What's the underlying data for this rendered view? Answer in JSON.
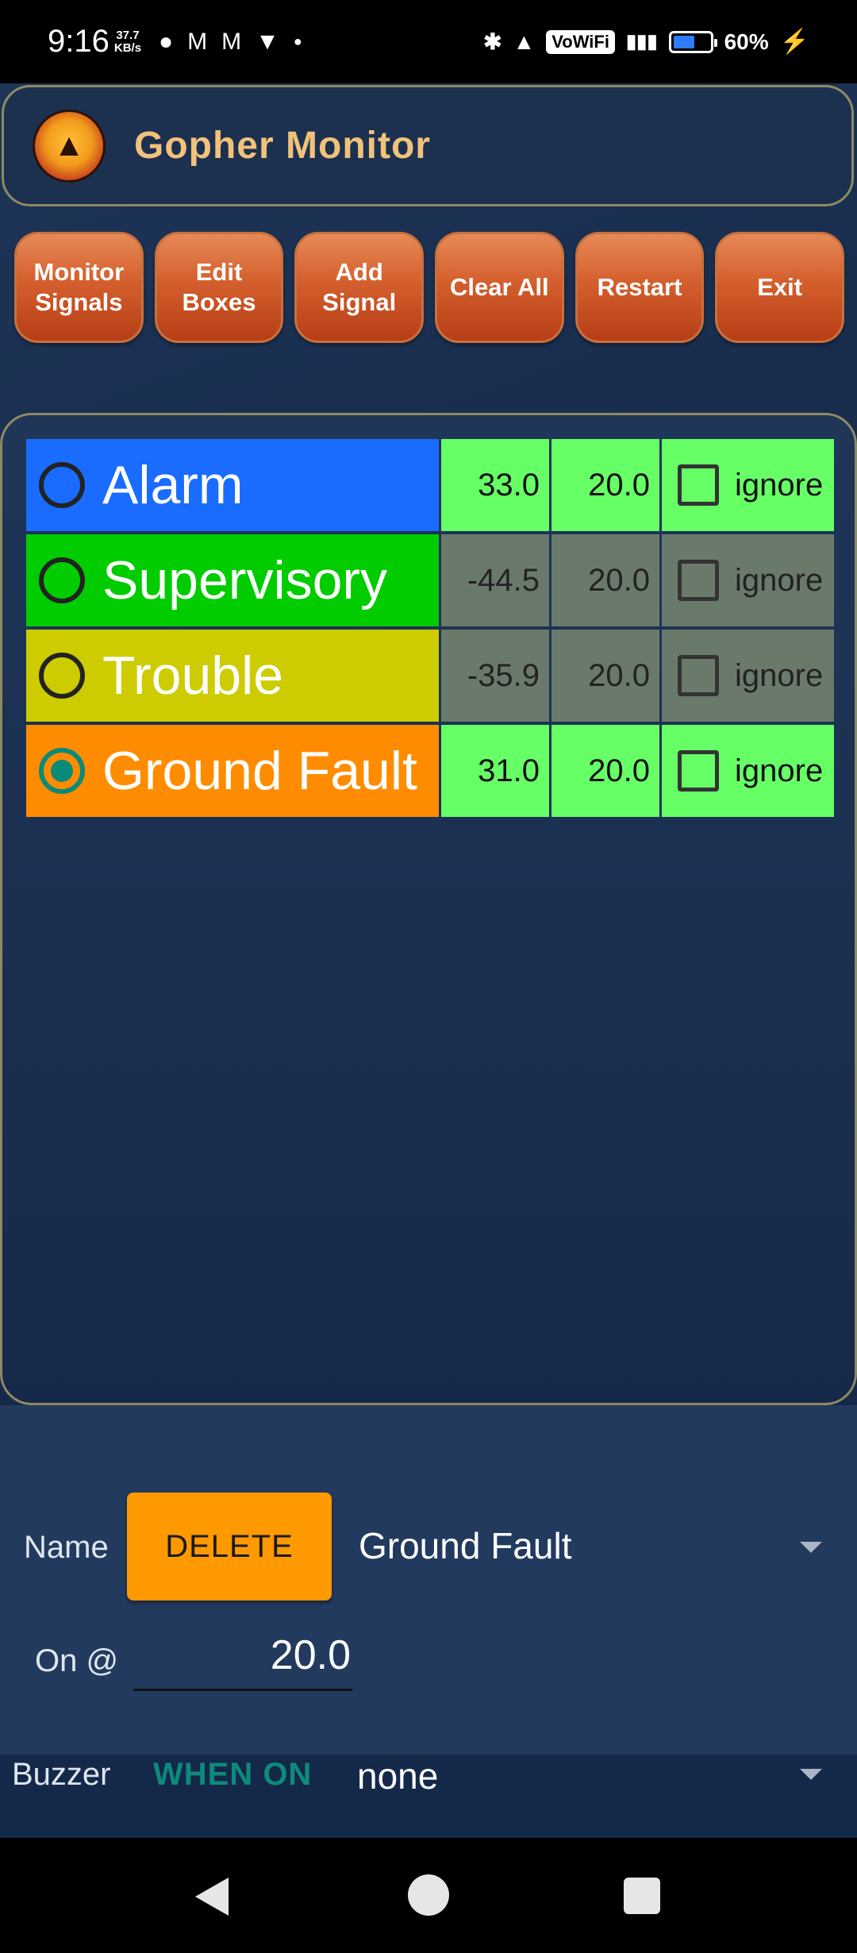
{
  "status_bar": {
    "time": "9:16",
    "net_speed_value": "37.7",
    "net_speed_unit": "KB/s",
    "vowifi": "VoWiFi",
    "battery": "60%"
  },
  "app": {
    "title": "Gopher Monitor"
  },
  "toolbar": {
    "buttons": [
      "Monitor\nSignals",
      "Edit Boxes",
      "Add\nSignal",
      "Clear All",
      "Restart",
      "Exit"
    ]
  },
  "signals": [
    {
      "name": "Alarm",
      "value": "33.0",
      "threshold": "20.0",
      "ignore_label": "ignore",
      "color": "#1a6cff",
      "active": true,
      "selected": false
    },
    {
      "name": "Supervisory",
      "value": "-44.5",
      "threshold": "20.0",
      "ignore_label": "ignore",
      "color": "#00cc00",
      "active": false,
      "selected": false
    },
    {
      "name": "Trouble",
      "value": "-35.9",
      "threshold": "20.0",
      "ignore_label": "ignore",
      "color": "#cccc00",
      "active": false,
      "selected": false
    },
    {
      "name": "Ground Fault",
      "value": "31.0",
      "threshold": "20.0",
      "ignore_label": "ignore",
      "color": "#ff8c00",
      "active": true,
      "selected": true
    }
  ],
  "controls": {
    "name_label": "Name",
    "delete_label": "DELETE",
    "selected_name": "Ground Fault",
    "on_label": "On @",
    "on_value": "20.0",
    "buzzer_label": "Buzzer",
    "buzzer_mode": "WHEN ON",
    "buzzer_value": "none"
  }
}
